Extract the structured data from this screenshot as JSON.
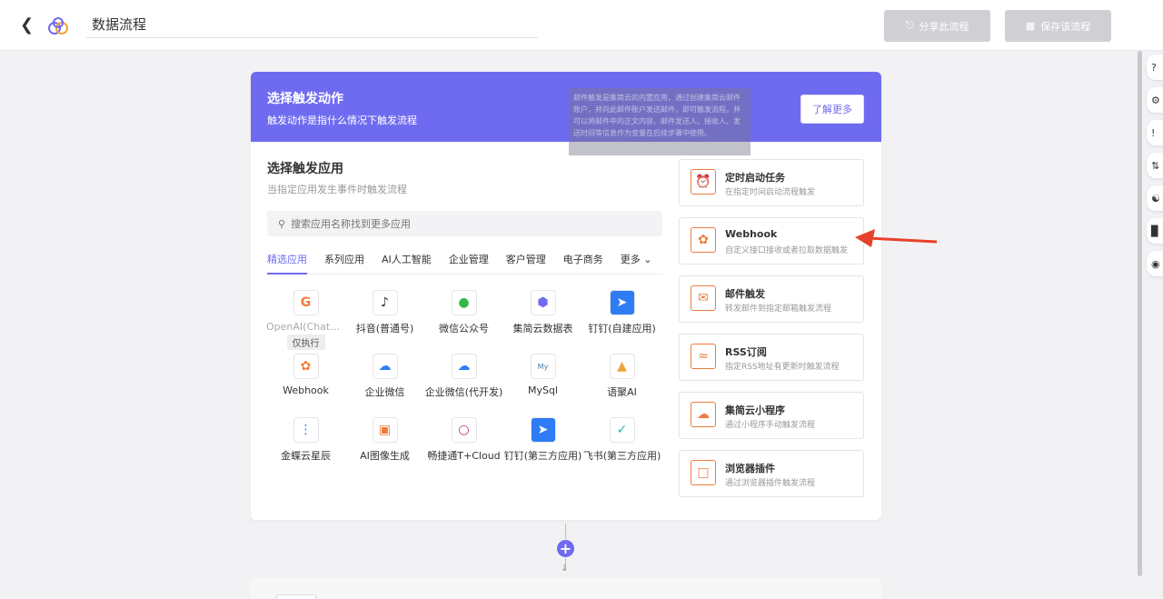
{
  "topbar": {
    "back_icon": "chevron-left-icon",
    "logo_icon": "cloud-flow-logo",
    "title_value": "数据流程",
    "share_label": "分享此流程",
    "save_label": "保存该流程"
  },
  "header": {
    "title": "选择触发动作",
    "subtitle": "触发动作是指什么情况下触发流程",
    "learn_more": "了解更多",
    "tooltip": "邮件触发是集简云的内置应用，通过创建集简云邮件账户，并向此邮件账户发送邮件，即可触发流程。并可以将邮件中的正文内容、邮件发送人、接收人、发送时间等信息作为变量在后续步骤中使用。"
  },
  "apps_section": {
    "title": "选择触发应用",
    "subtitle": "当指定应用发生事件时触发流程",
    "search_placeholder": "搜索应用名称找到更多应用",
    "tabs": [
      "精选应用",
      "系列应用",
      "AI人工智能",
      "企业管理",
      "客户管理",
      "电子商务",
      "更多"
    ],
    "apps": [
      {
        "label": "OpenAI(ChatGPT)",
        "tag": "仅执行",
        "icon": "openai-icon"
      },
      {
        "label": "抖音(普通号)",
        "icon": "douyin-icon"
      },
      {
        "label": "微信公众号",
        "icon": "wechat-icon"
      },
      {
        "label": "集简云数据表",
        "icon": "jijianyun-table-icon"
      },
      {
        "label": "钉钉(自建应用)",
        "icon": "dingtalk-icon"
      },
      {
        "label": "Webhook",
        "icon": "webhook-icon"
      },
      {
        "label": "企业微信",
        "icon": "wecom-icon"
      },
      {
        "label": "企业微信(代开发)",
        "icon": "wecom-icon"
      },
      {
        "label": "MySql",
        "icon": "mysql-icon"
      },
      {
        "label": "语聚AI",
        "icon": "yuju-ai-icon"
      },
      {
        "label": "金蝶云星辰",
        "icon": "kingdee-icon"
      },
      {
        "label": "AI图像生成",
        "icon": "ai-image-icon"
      },
      {
        "label": "畅捷通T+Cloud",
        "icon": "chanjet-icon"
      },
      {
        "label": "钉钉(第三方应用)",
        "icon": "dingtalk-icon"
      },
      {
        "label": "飞书(第三方应用)",
        "icon": "feishu-icon"
      }
    ]
  },
  "triggers": [
    {
      "title": "定时启动任务",
      "desc": "在指定时间启动流程触发",
      "icon": "alarm-clock-icon"
    },
    {
      "title": "Webhook",
      "desc": "自定义接口接收或者拉取数据触发",
      "icon": "webhook-icon"
    },
    {
      "title": "邮件触发",
      "desc": "转发邮件到指定邮箱触发流程",
      "icon": "mail-icon"
    },
    {
      "title": "RSS订阅",
      "desc": "指定RSS地址有更新时触发流程",
      "icon": "rss-icon"
    },
    {
      "title": "集简云小程序",
      "desc": "通过小程序手动触发流程",
      "icon": "cloud-icon"
    },
    {
      "title": "浏览器插件",
      "desc": "通过浏览器插件触发流程",
      "icon": "browser-icon"
    }
  ],
  "rail_icons": [
    "help-icon",
    "gear-icon",
    "alert-icon",
    "sort-icon",
    "flow-icon",
    "chart-icon",
    "location-icon"
  ],
  "colors": {
    "accent": "#6f6bf0",
    "trigger_icon": "#f07a3a",
    "arrow": "#e8402a"
  }
}
